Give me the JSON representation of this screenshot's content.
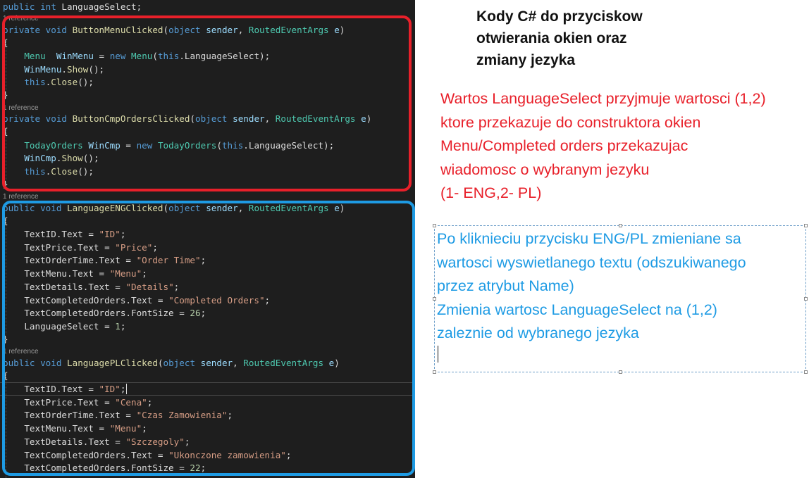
{
  "editor": {
    "references": {
      "r1": "1 reference",
      "r2": "1 reference",
      "r3": "1 reference",
      "r4": "1 reference"
    },
    "lines": {
      "l0": {
        "kw1": "public",
        "kw2": "int",
        "rest": " LanguageSelect;"
      },
      "l1": {
        "kw1": "private",
        "kw2": "void",
        "method": "ButtonMenuClicked",
        "open": "(",
        "kw3": "object",
        "p1": "sender",
        "comma": ", ",
        "type": "RoutedEventArgs",
        "p2": "e",
        "close": ")"
      },
      "l2": "{",
      "l3": {
        "type1": "Menu",
        "var": "WinMenu",
        "eq": " = ",
        "kw": "new",
        "type2": "Menu",
        "open": "(",
        "kw2": "this",
        "rest": ".LanguageSelect);"
      },
      "l4": {
        "var": "WinMenu",
        "dot": ".",
        "method": "Show",
        "rest": "();"
      },
      "l5": {
        "kw": "this",
        "dot": ".",
        "method": "Close",
        "rest": "();"
      },
      "l6": "}",
      "l7": {
        "kw1": "private",
        "kw2": "void",
        "method": "ButtonCmpOrdersClicked",
        "open": "(",
        "kw3": "object",
        "p1": "sender",
        "comma": ", ",
        "type": "RoutedEventArgs",
        "p2": "e",
        "close": ")"
      },
      "l8": "{",
      "l9": {
        "type1": "TodayOrders",
        "var": "WinCmp",
        "eq": " = ",
        "kw": "new",
        "type2": "TodayOrders",
        "open": "(",
        "kw2": "this",
        "rest": ".LanguageSelect);"
      },
      "l10": {
        "var": "WinCmp",
        "dot": ".",
        "method": "Show",
        "rest": "();"
      },
      "l11": {
        "kw": "this",
        "dot": ".",
        "method": "Close",
        "rest": "();"
      },
      "l12": "}",
      "l13": {
        "kw1": "public",
        "kw2": "void",
        "method": "LanguageENGClicked",
        "open": "(",
        "kw3": "object",
        "p1": "sender",
        "comma": ", ",
        "type": "RoutedEventArgs",
        "p2": "e",
        "close": ")"
      },
      "l14": "{",
      "l15": {
        "lhs": "TextID.Text = ",
        "str": "\"ID\"",
        "end": ";"
      },
      "l16": {
        "lhs": "TextPrice.Text = ",
        "str": "\"Price\"",
        "end": ";"
      },
      "l17": {
        "lhs": "TextOrderTime.Text = ",
        "str": "\"Order Time\"",
        "end": ";"
      },
      "l18": {
        "lhs": "TextMenu.Text = ",
        "str": "\"Menu\"",
        "end": ";"
      },
      "l19": {
        "lhs": "TextDetails.Text = ",
        "str": "\"Details\"",
        "end": ";"
      },
      "l20": {
        "lhs": "TextCompletedOrders.Text = ",
        "str": "\"Completed Orders\"",
        "end": ";"
      },
      "l21": {
        "lhs": "TextCompletedOrders.FontSize = ",
        "num": "26",
        "end": ";"
      },
      "l22": {
        "lhs": "LanguageSelect = ",
        "num": "1",
        "end": ";"
      },
      "l23": "}",
      "l24": {
        "kw1": "public",
        "kw2": "void",
        "method": "LanguagePLClicked",
        "open": "(",
        "kw3": "object",
        "p1": "sender",
        "comma": ", ",
        "type": "RoutedEventArgs",
        "p2": "e",
        "close": ")"
      },
      "l25": "{",
      "l26": {
        "lhs": "TextID.Text = ",
        "str": "\"ID\"",
        "end": ";"
      },
      "l27": {
        "lhs": "TextPrice.Text = ",
        "str": "\"Cena\"",
        "end": ";"
      },
      "l28": {
        "lhs": "TextOrderTime.Text = ",
        "str": "\"Czas Zamowienia\"",
        "end": ";"
      },
      "l29": {
        "lhs": "TextMenu.Text = ",
        "str": "\"Menu\"",
        "end": ";"
      },
      "l30": {
        "lhs": "TextDetails.Text = ",
        "str": "\"Szczegoly\"",
        "end": ";"
      },
      "l31": {
        "lhs": "TextCompletedOrders.Text = ",
        "str": "\"Ukonczone zamowienia\"",
        "end": ";"
      },
      "l32": {
        "lhs": "TextCompletedOrders.FontSize = ",
        "num": "22",
        "end": ";"
      }
    }
  },
  "annotations": {
    "title_lines": [
      "Kody C# do przyciskow",
      "otwierania okien oraz",
      "zmiany jezyka"
    ],
    "red_lines": [
      "Wartos LanguageSelect przyjmuje wartosci (1,2)",
      "ktore przekazuje do construktora okien",
      "Menu/Completed orders przekazujac",
      "wiadomosc o wybranym jezyku",
      "(1- ENG,2- PL)"
    ],
    "blue_lines": [
      "Po kliknieciu przycisku ENG/PL zmieniane sa",
      "wartosci wyswietlanego textu (odszukiwanego",
      "przez atrybut Name)",
      "Zmienia wartosc LanguageSelect na (1,2)",
      "zaleznie od wybranego jezyka"
    ],
    "colors": {
      "red": "#e8202a",
      "blue": "#1e9be4"
    }
  }
}
